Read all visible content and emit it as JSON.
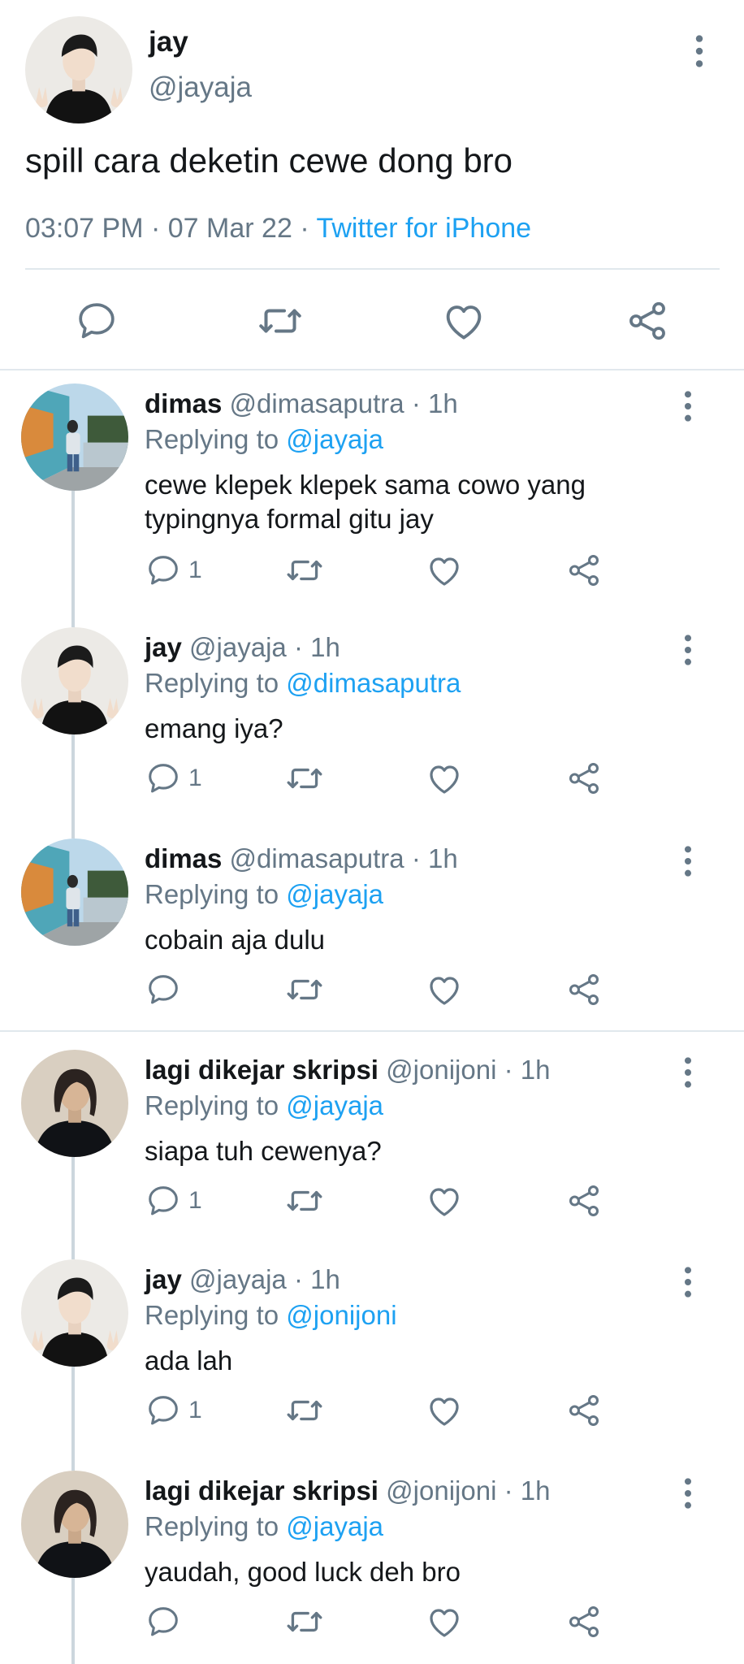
{
  "main_tweet": {
    "name": "jay",
    "handle": "@jayaja",
    "text": "spill cara deketin cewe dong bro",
    "time": "03:07 PM",
    "date": "07 Mar 22",
    "separator": "·",
    "client": "Twitter for iPhone",
    "actions": [
      "comment-icon",
      "retweet-icon",
      "like-icon",
      "share-icon"
    ]
  },
  "replies": [
    {
      "name": "dimas",
      "handle": "@dimasaputra",
      "time": "1h",
      "replying_label": "Replying to",
      "replying_to": "@jayaja",
      "text": "cewe klepek klepek sama cowo yang typingnya formal gitu jay",
      "reply_count": "1",
      "avatar": "street-photo"
    },
    {
      "name": "jay",
      "handle": "@jayaja",
      "time": "1h",
      "replying_label": "Replying to",
      "replying_to": "@dimasaputra",
      "text": "emang iya?",
      "reply_count": "1",
      "avatar": "black-sweater-peace"
    },
    {
      "name": "dimas",
      "handle": "@dimasaputra",
      "time": "1h",
      "replying_label": "Replying to",
      "replying_to": "@jayaja",
      "text": "cobain aja dulu",
      "reply_count": "",
      "avatar": "street-photo"
    },
    {
      "name": "lagi dikejar skripsi",
      "handle": "@jonijoni",
      "time": "1h",
      "replying_label": "Replying to",
      "replying_to": "@jayaja",
      "text": "siapa tuh cewenya?",
      "reply_count": "1",
      "avatar": "long-hair"
    },
    {
      "name": "jay",
      "handle": "@jayaja",
      "time": "1h",
      "replying_label": "Replying to",
      "replying_to": "@jonijoni",
      "text": "ada lah",
      "reply_count": "1",
      "avatar": "black-sweater-peace"
    },
    {
      "name": "lagi dikejar skripsi",
      "handle": "@jonijoni",
      "time": "1h",
      "replying_label": "Replying to",
      "replying_to": "@jayaja",
      "text": "yaudah, good luck deh bro",
      "reply_count": "",
      "avatar": "long-hair"
    }
  ],
  "colors": {
    "link": "#1da1f2",
    "muted": "#657786",
    "text": "#14171a",
    "divider": "#e1e8ed"
  }
}
